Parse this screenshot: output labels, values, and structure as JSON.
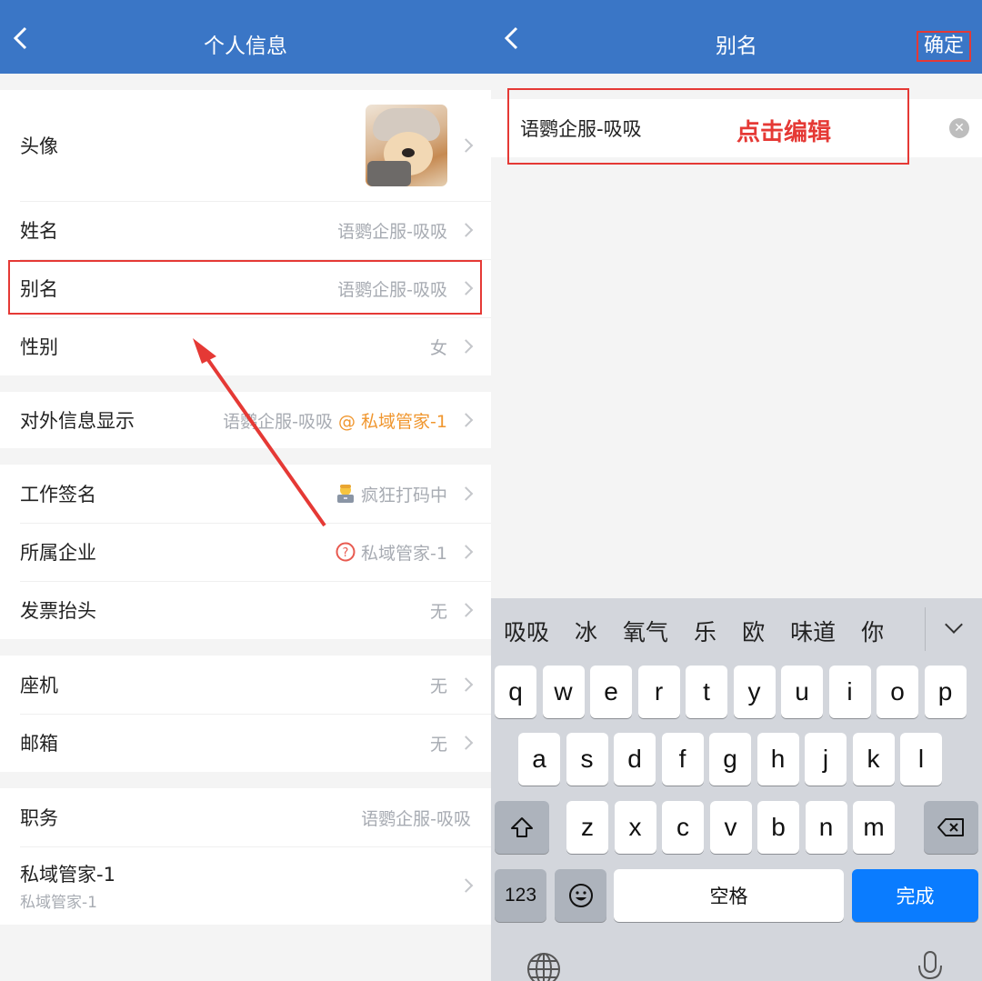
{
  "left": {
    "nav": {
      "back_icon": "chevron-left-icon",
      "title": "个人信息"
    },
    "groups": [
      {
        "rows": [
          {
            "label": "头像",
            "type": "avatar"
          },
          {
            "label": "姓名",
            "value": "语鹦企服-吸吸"
          },
          {
            "label": "别名",
            "value": "语鹦企服-吸吸",
            "highlighted": true
          },
          {
            "label": "性别",
            "value": "女"
          }
        ]
      },
      {
        "rows": [
          {
            "label": "对外信息显示",
            "value": "语鹦企服-吸吸",
            "value_accent": "@ 私域管家-1"
          }
        ]
      },
      {
        "rows": [
          {
            "label": "工作签名",
            "icon": "technologist-emoji-icon",
            "value": "疯狂打码中"
          },
          {
            "label": "所属企业",
            "icon": "question-circle-icon",
            "value": "私域管家-1"
          },
          {
            "label": "发票抬头",
            "value": "无"
          }
        ]
      },
      {
        "rows": [
          {
            "label": "座机",
            "value": "无"
          },
          {
            "label": "邮箱",
            "value": "无"
          }
        ]
      },
      {
        "rows": [
          {
            "label": "职务",
            "value": "语鹦企服-吸吸"
          },
          {
            "label": "私域管家-1",
            "sublabel": "私域管家-1"
          }
        ]
      }
    ]
  },
  "right": {
    "nav": {
      "back_icon": "chevron-left-icon",
      "title": "别名",
      "confirm_label": "确定"
    },
    "input": {
      "value": "语鹦企服-吸吸",
      "annotation": "点击编辑"
    },
    "keyboard": {
      "candidates": [
        "吸吸",
        "冰",
        "氧气",
        "乐",
        "欧",
        "味道",
        "你"
      ],
      "row1": [
        "q",
        "w",
        "e",
        "r",
        "t",
        "y",
        "u",
        "i",
        "o",
        "p"
      ],
      "row2": [
        "a",
        "s",
        "d",
        "f",
        "g",
        "h",
        "j",
        "k",
        "l"
      ],
      "row3": [
        "z",
        "x",
        "c",
        "v",
        "b",
        "n",
        "m"
      ],
      "num_label": "123",
      "space_label": "空格",
      "done_label": "完成"
    }
  },
  "colors": {
    "nav_blue": "#3a76c6",
    "annotation_red": "#e53935",
    "accent_orange": "#f0962e",
    "done_blue": "#0a7cff"
  }
}
